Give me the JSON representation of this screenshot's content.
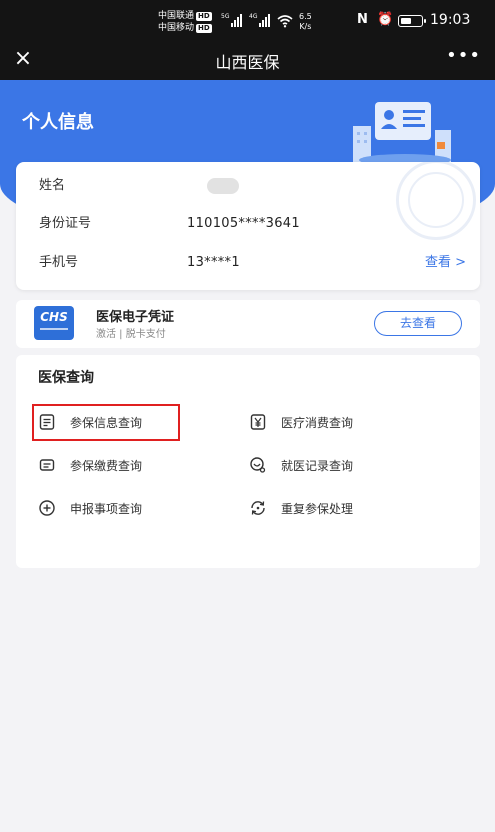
{
  "status_bar": {
    "carrier_1": "中国联通",
    "carrier_2": "中国移动",
    "hd_badge": "HD",
    "gen_1": "5G",
    "gen_2": "4G",
    "speed_value": "6.5",
    "speed_unit": "K/s",
    "nfc_glyph": "N",
    "battery_level": 0.55,
    "time": "19:03"
  },
  "navbar": {
    "close_glyph": "×",
    "title": "山西医保",
    "more_glyph": "•••"
  },
  "header": {
    "title": "个人信息"
  },
  "info_card": {
    "name_label": "姓名",
    "id_label": "身份证号",
    "id_value": "110105****3641",
    "phone_label": "手机号",
    "phone_value": "13****1",
    "view_link": "查看 >"
  },
  "voucher": {
    "logo_text": "CHS",
    "title": "医保电子凭证",
    "subtitle": "激活 | 脱卡支付",
    "button": "去查看"
  },
  "query": {
    "title": "医保查询",
    "items": [
      {
        "label": "参保信息查询",
        "icon": "document-icon"
      },
      {
        "label": "医疗消费查询",
        "icon": "yuan-icon"
      },
      {
        "label": "参保缴费查询",
        "icon": "receipt-icon"
      },
      {
        "label": "就医记录查询",
        "icon": "stethoscope-icon"
      },
      {
        "label": "申报事项查询",
        "icon": "plus-circle-icon"
      },
      {
        "label": "重复参保处理",
        "icon": "refresh-icon"
      }
    ]
  },
  "colors": {
    "accent": "#3b76e6",
    "highlight": "#e02020",
    "bar": "#141414"
  }
}
